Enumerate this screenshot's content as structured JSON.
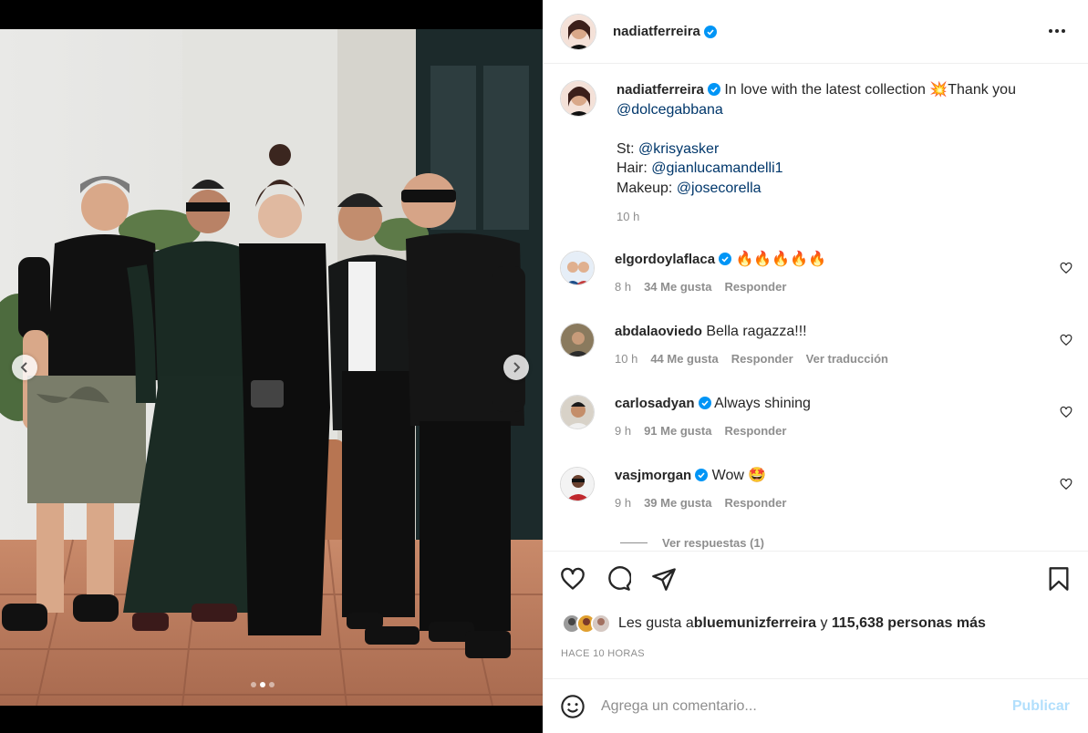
{
  "post": {
    "author": "nadiatferreira",
    "carousel_dots": 3,
    "carousel_active": 1
  },
  "header": {
    "username": "nadiatferreira",
    "more_icon": "more-horizontal-icon"
  },
  "caption": {
    "username": "nadiatferreira",
    "text_1": "In love with the latest collection 💥Thank you",
    "mention_1": "@dolcegabbana",
    "st_label": "St: ",
    "st_mention": "@krisyasker",
    "hair_label": "Hair: ",
    "hair_mention": "@gianlucamandelli1",
    "makeup_label": "Makeup: ",
    "makeup_mention": "@josecorella",
    "time": "10 h"
  },
  "comments": [
    {
      "username": "elgordoylaflaca",
      "verified": true,
      "text": "🔥🔥🔥🔥🔥",
      "time": "8 h",
      "likes": "34 Me gusta",
      "reply": "Responder",
      "translate": ""
    },
    {
      "username": "abdalaoviedo",
      "verified": false,
      "text": "Bella ragazza!!!",
      "time": "10 h",
      "likes": "44 Me gusta",
      "reply": "Responder",
      "translate": "Ver traducción"
    },
    {
      "username": "carlosadyan",
      "verified": true,
      "text": "Always shining",
      "time": "9 h",
      "likes": "91 Me gusta",
      "reply": "Responder",
      "translate": ""
    },
    {
      "username": "vasjmorgan",
      "verified": true,
      "text": "Wow 🤩",
      "time": "9 h",
      "likes": "39 Me gusta",
      "reply": "Responder",
      "translate": ""
    }
  ],
  "view_replies": "Ver respuestas (1)",
  "likes": {
    "prefix": "Les gusta a ",
    "user": "bluemunizferreira",
    "middle": " y ",
    "count": "115,638 personas más"
  },
  "timestamp": "HACE 10 HORAS",
  "composer": {
    "placeholder": "Agrega un comentario...",
    "publish": "Publicar"
  },
  "colors": {
    "verified": "#0095f6",
    "mention": "#00376b",
    "muted": "#8e8e8e",
    "publish_disabled": "#b2dffc"
  }
}
